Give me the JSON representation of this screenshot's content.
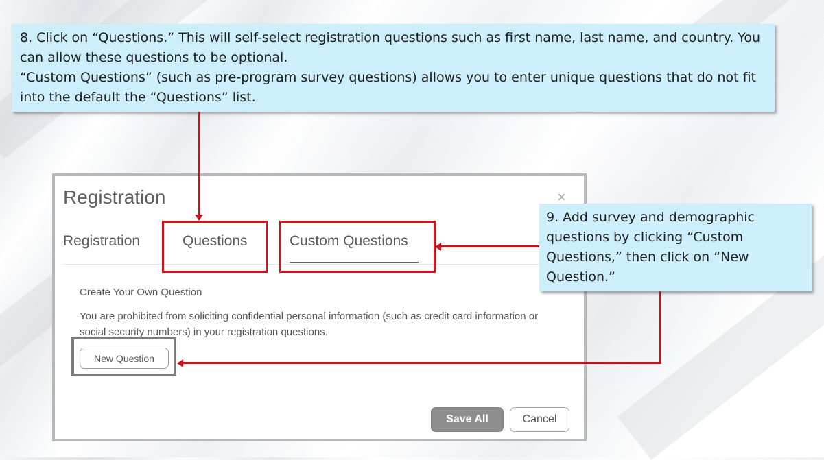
{
  "callouts": {
    "step8": {
      "number": "8.",
      "line1": " Click on “Questions.” This will self-select registration questions such as first name, last name, and country. You can allow these questions to be optional.",
      "line2": "“Custom Questions” (such as pre-program survey questions) allows you to enter unique questions that do not fit into the default the “Questions” list."
    },
    "step9": {
      "number": "9.",
      "text": " Add survey and demographic questions by clicking “Custom Questions,” then click on “New Question.”"
    }
  },
  "modal": {
    "title": "Registration",
    "close_label": "×",
    "tabs": [
      {
        "label": "Registration"
      },
      {
        "label": "Questions"
      },
      {
        "label": "Custom Questions",
        "active": true
      }
    ],
    "section_heading": "Create Your Own Question",
    "section_note": "You are prohibited from soliciting confidential personal information (such as credit card information or social security numbers) in your registration questions.",
    "new_question_label": "New Question",
    "save_all_label": "Save All",
    "cancel_label": "Cancel"
  },
  "colors": {
    "callout_bg": "#cdeefb",
    "highlight_red": "#d0141b",
    "highlight_gray": "#7c7c7c"
  }
}
